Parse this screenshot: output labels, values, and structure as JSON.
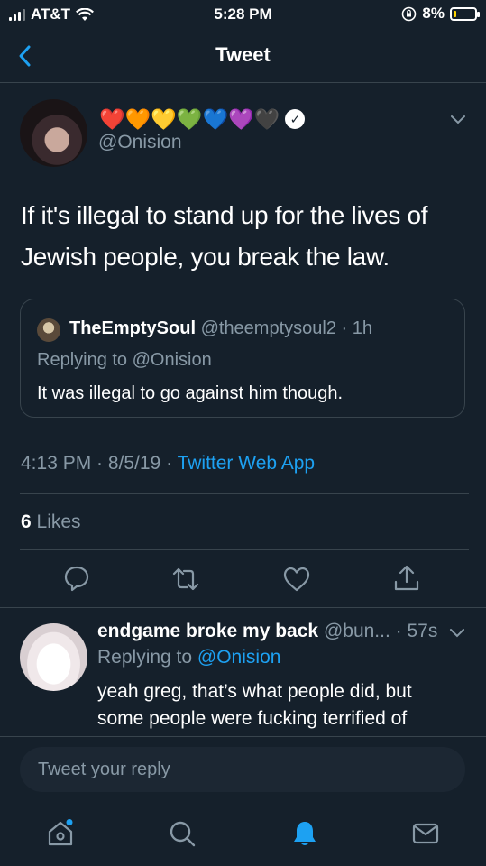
{
  "status_bar": {
    "carrier": "AT&T",
    "time": "5:28 PM",
    "battery": "8%"
  },
  "nav": {
    "title": "Tweet"
  },
  "tweet": {
    "emoji_name": "❤️🧡💛💚💙💜🖤",
    "handle": "@Onision",
    "text": "If it's illegal to stand up for the lives of Jewish people, you break the law.",
    "quote": {
      "name": "TheEmptySoul",
      "handle_time": "@theemptysoul2 · 1h",
      "replying_to": "Replying to @Onision",
      "text": "It was illegal to go against him though."
    },
    "meta": {
      "time": "4:13 PM",
      "date": "8/5/19",
      "source": "Twitter Web App"
    },
    "likes": {
      "count": "6",
      "label": "Likes"
    }
  },
  "reply": {
    "name": "endgame broke my back",
    "handle_time": "@bun... · 57s",
    "replying_prefix": "Replying to ",
    "replying_handle": "@Onision",
    "text": "yeah greg, that’s what people did, but some people were fucking terrified of"
  },
  "compose": {
    "placeholder": "Tweet your reply"
  },
  "colors": {
    "background": "#15202b",
    "accent": "#1da1f2",
    "muted": "#8899a6",
    "border": "#38444d"
  },
  "icons": {
    "actions": [
      "reply-icon",
      "retweet-icon",
      "like-icon",
      "share-icon"
    ],
    "tabs": [
      "home-icon",
      "search-icon",
      "notifications-icon",
      "messages-icon"
    ]
  }
}
